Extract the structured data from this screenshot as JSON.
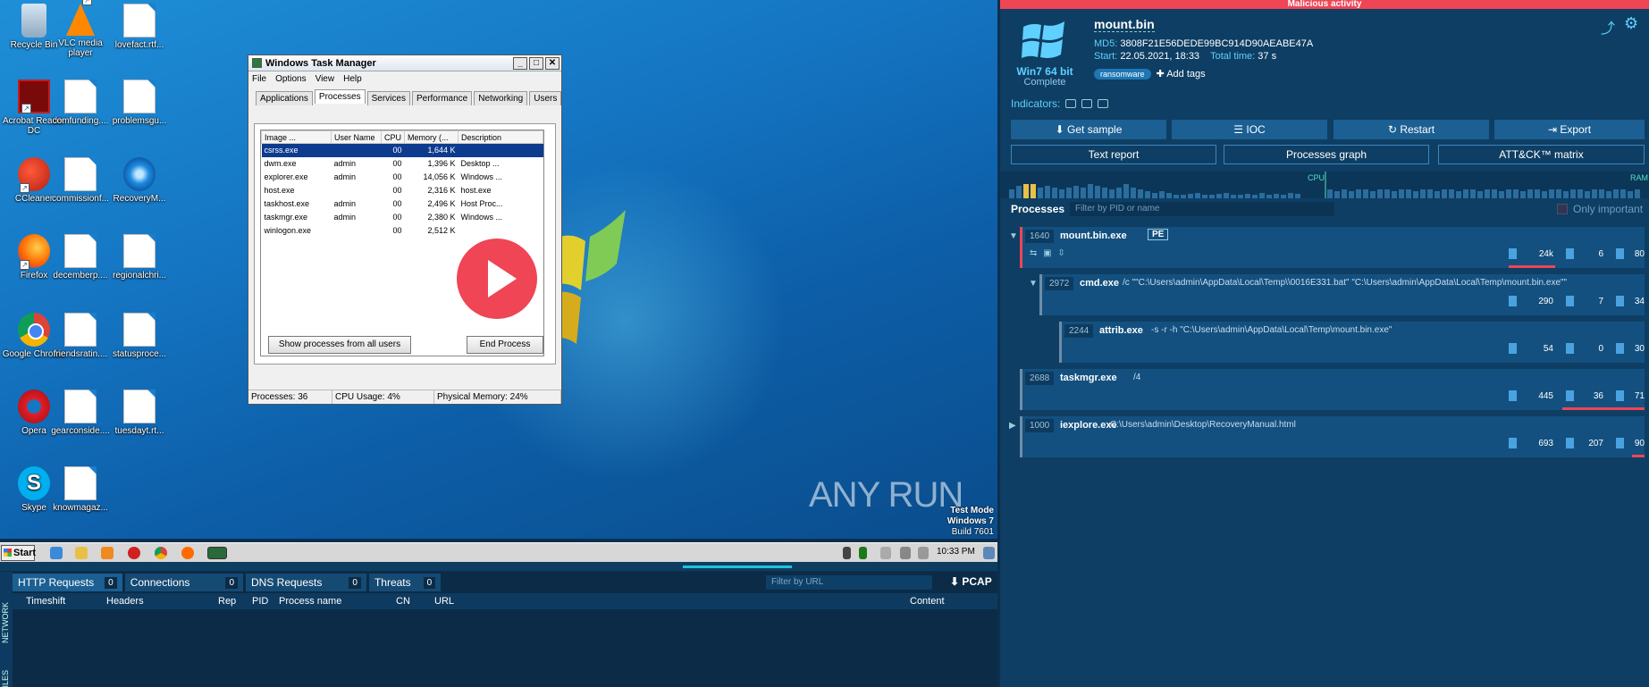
{
  "desktop": {
    "icons": [
      {
        "label": "Recycle Bin",
        "icon": "recycle-bin-icon"
      },
      {
        "label": "VLC media player",
        "icon": "vlc-icon"
      },
      {
        "label": "lovefact.rtf...",
        "icon": "document-icon"
      },
      {
        "label": "Acrobat Reader DC",
        "icon": "acrobat-icon"
      },
      {
        "label": "comfunding....",
        "icon": "document-icon"
      },
      {
        "label": "problemsgu...",
        "icon": "document-icon"
      },
      {
        "label": "CCleaner",
        "icon": "ccleaner-icon"
      },
      {
        "label": "commissionf...",
        "icon": "document-icon"
      },
      {
        "label": "RecoveryM...",
        "icon": "internet-explorer-icon"
      },
      {
        "label": "Firefox",
        "icon": "firefox-icon"
      },
      {
        "label": "decemberp....",
        "icon": "document-icon"
      },
      {
        "label": "regionalchri...",
        "icon": "document-icon"
      },
      {
        "label": "Google Chrome",
        "icon": "chrome-icon"
      },
      {
        "label": "friendsratin....",
        "icon": "document-icon"
      },
      {
        "label": "statusproce...",
        "icon": "document-icon"
      },
      {
        "label": "Opera",
        "icon": "opera-icon"
      },
      {
        "label": "gearconside....",
        "icon": "document-icon"
      },
      {
        "label": "tuesdayt.rt...",
        "icon": "document-icon"
      },
      {
        "label": "Skype",
        "icon": "skype-icon"
      },
      {
        "label": "knowmagaz...",
        "icon": "document-icon"
      }
    ],
    "watermark": {
      "line1": "Test Mode",
      "line2": "Windows 7",
      "line3": "Build 7601"
    },
    "brand": "ANY RUN"
  },
  "taskmgr": {
    "title": "Windows Task Manager",
    "minimize": "_",
    "maximize": "□",
    "close": "✕",
    "menu": [
      "File",
      "Options",
      "View",
      "Help"
    ],
    "tabs": [
      "Applications",
      "Processes",
      "Services",
      "Performance",
      "Networking",
      "Users"
    ],
    "active_tab": "Processes",
    "columns": [
      "Image ...",
      "User Name",
      "CPU",
      "Memory (...",
      "Description"
    ],
    "rows": [
      {
        "image": "csrss.exe",
        "user": "",
        "cpu": "00",
        "mem": "1,644 K",
        "desc": ""
      },
      {
        "image": "dwm.exe",
        "user": "admin",
        "cpu": "00",
        "mem": "1,396 K",
        "desc": "Desktop ..."
      },
      {
        "image": "explorer.exe",
        "user": "admin",
        "cpu": "00",
        "mem": "14,056 K",
        "desc": "Windows ..."
      },
      {
        "image": "host.exe",
        "user": "",
        "cpu": "00",
        "mem": "2,316 K",
        "desc": "host.exe"
      },
      {
        "image": "taskhost.exe",
        "user": "admin",
        "cpu": "00",
        "mem": "2,496 K",
        "desc": "Host Proc..."
      },
      {
        "image": "taskmgr.exe",
        "user": "admin",
        "cpu": "00",
        "mem": "2,380 K",
        "desc": "Windows ..."
      },
      {
        "image": "winlogon.exe",
        "user": "",
        "cpu": "00",
        "mem": "2,512 K",
        "desc": ""
      }
    ],
    "show_all_btn": "Show processes from all users",
    "end_btn": "End Process",
    "status": {
      "processes": "Processes: 36",
      "cpu": "CPU Usage: 4%",
      "memory": "Physical Memory: 24%"
    }
  },
  "taskbar": {
    "start": "Start",
    "clock": "10:33 PM"
  },
  "network": {
    "side_network": "NETWORK",
    "side_files": "FILES",
    "tabs": [
      {
        "label": "HTTP Requests",
        "count": "0"
      },
      {
        "label": "Connections",
        "count": "0"
      },
      {
        "label": "DNS Requests",
        "count": "0"
      },
      {
        "label": "Threats",
        "count": "0"
      }
    ],
    "filter_placeholder": "Filter by URL",
    "pcap": "⬇ PCAP",
    "columns": [
      "Timeshift",
      "Headers",
      "Rep",
      "PID",
      "Process name",
      "CN",
      "URL",
      "Content"
    ]
  },
  "report": {
    "verdict": "Malicious activity",
    "os_name": "Win7 64 bit",
    "os_status": "Complete",
    "file_name": "mount.bin",
    "md5_label": "MD5:",
    "md5": "3808F21E56DEDE99BC914D90AEABE47A",
    "start_label": "Start:",
    "start": "22.05.2021, 18:33",
    "total_label": "Total time:",
    "total": "37 s",
    "tag": "ransomware",
    "add_tags": "✚ Add tags",
    "indicators": "Indicators:",
    "buttons": [
      "Get sample",
      "IOC",
      "Restart",
      "Export"
    ],
    "outline_buttons": [
      "Text report",
      "Processes graph",
      "ATT&CK™ matrix"
    ],
    "cpu_label": "CPU",
    "ram_label": "RAM",
    "processes_title": "Processes",
    "filter_placeholder": "Filter by PID or name",
    "only_important": "Only important",
    "accent": "#5fd0ff",
    "alert": "#ef4555",
    "processes": [
      {
        "pid": "1640",
        "name": "mount.bin.exe",
        "args": "",
        "badge": "PE",
        "files": "24k",
        "modules": "6",
        "registry": "80"
      },
      {
        "pid": "2972",
        "name": "cmd.exe",
        "args": "/c \"\"C:\\Users\\admin\\AppData\\Local\\Temp\\\\0016E331.bat\" \"C:\\Users\\admin\\AppData\\Local\\Temp\\mount.bin.exe\"\"",
        "badge": "",
        "files": "290",
        "modules": "7",
        "registry": "34"
      },
      {
        "pid": "2244",
        "name": "attrib.exe",
        "args": "-s -r -h \"C:\\Users\\admin\\AppData\\Local\\Temp\\mount.bin.exe\"",
        "badge": "",
        "files": "54",
        "modules": "0",
        "registry": "30"
      },
      {
        "pid": "2688",
        "name": "taskmgr.exe",
        "args": "/4",
        "badge": "",
        "files": "445",
        "modules": "36",
        "registry": "71"
      },
      {
        "pid": "1000",
        "name": "iexplore.exe",
        "args": "C:\\Users\\admin\\Desktop\\RecoveryManual.html",
        "badge": "",
        "files": "693",
        "modules": "207",
        "registry": "90"
      }
    ]
  }
}
